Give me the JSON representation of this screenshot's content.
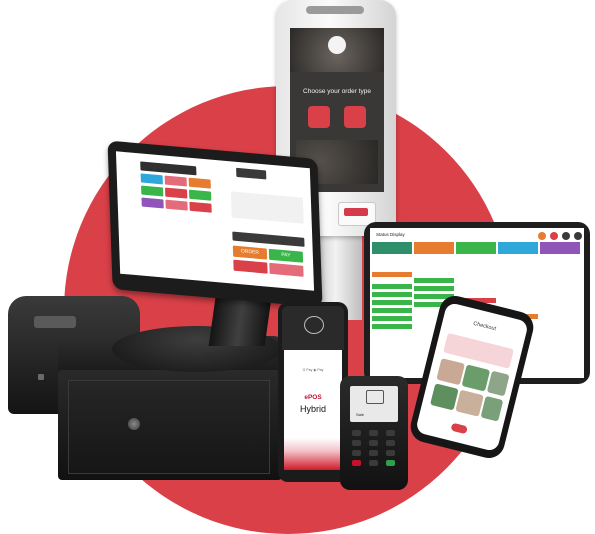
{
  "colors": {
    "brand_red": "#d94048",
    "device_black": "#1a1a1a",
    "kiosk_white": "#f2f2f2"
  },
  "kiosk": {
    "prompt": "Choose your order type"
  },
  "pos_terminal": {
    "button_labels": [
      "ORDER",
      "PAY"
    ]
  },
  "kitchen_display": {
    "title": "Status Display"
  },
  "phone": {
    "screen_title": "Checkout"
  },
  "epos_hybrid": {
    "brand_line1": "ePOS",
    "brand_line2": "Hybrid",
    "payment_marks": "G Pay  ◉  Pay"
  },
  "card_reader": {
    "screen_text": "Sale"
  }
}
